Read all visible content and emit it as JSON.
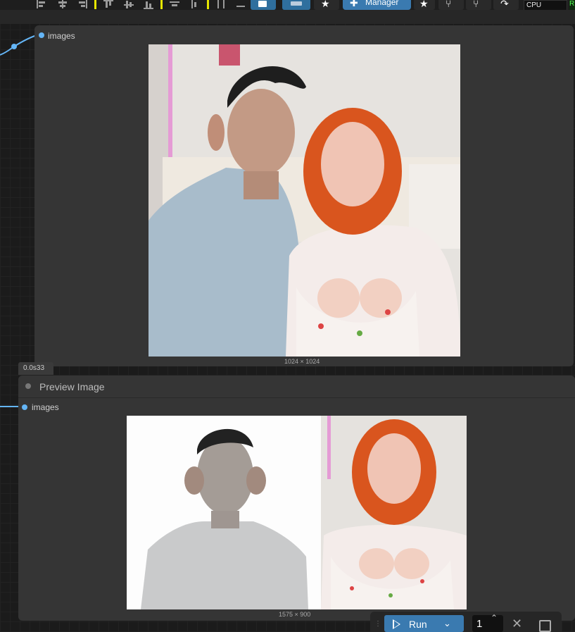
{
  "toolbar": {
    "manager_label": "Manager",
    "cpu_label": "CPU",
    "r_label": "R"
  },
  "node_top": {
    "output_label": "images",
    "image_dims": "1024 × 1024"
  },
  "timer": {
    "text": "0.0s33"
  },
  "preview_node": {
    "title": "Preview Image",
    "input_label": "images",
    "image_dims": "1575 × 900"
  },
  "runbar": {
    "run_label": "Run",
    "count": "1"
  },
  "colors": {
    "accent": "#3a7ab0",
    "link": "#64b5f6",
    "highlight": "#e6e600"
  },
  "icons": [
    "align-left-icon",
    "align-center-icon",
    "align-right-icon",
    "distribute-icon",
    "star-icon",
    "pin-icon",
    "arrow-icon",
    "close-icon",
    "square-icon",
    "play-icon",
    "chevron-down-icon",
    "chevron-up-icon"
  ]
}
